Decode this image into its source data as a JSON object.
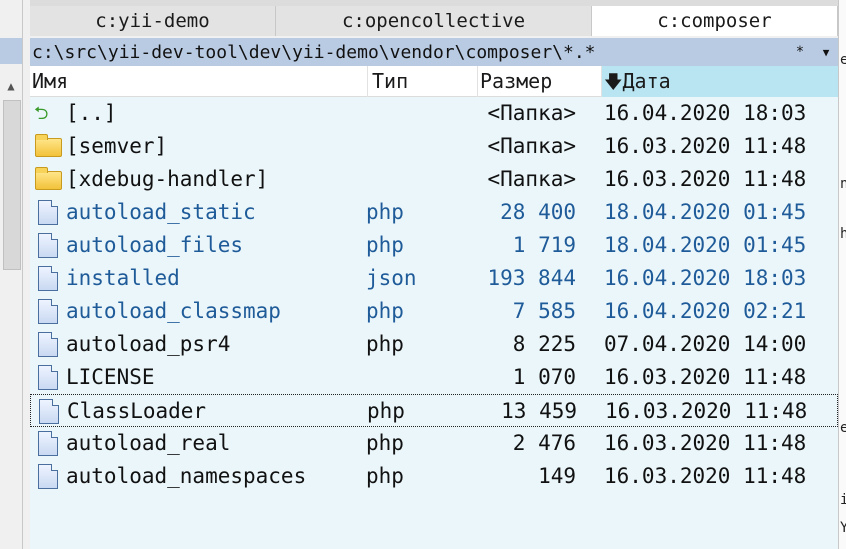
{
  "tabs": [
    {
      "label": "c:yii-demo",
      "active": false
    },
    {
      "label": "c:opencollective",
      "active": false
    },
    {
      "label": "c:composer",
      "active": true
    }
  ],
  "pathbar": {
    "path": "c:\\src\\yii-dev-tool\\dev\\yii-demo\\vendor\\composer\\*.*",
    "mask": "*",
    "dropdown_icon": "chevron-down-icon"
  },
  "columns": {
    "name": "Имя",
    "type": "Тип",
    "size": "Размер",
    "date": "Дата",
    "sort_icon": "sort-down-arrow-icon"
  },
  "files": [
    {
      "icon": "parent-dir-icon",
      "name": "[..]",
      "type": "",
      "size": "<Папка>",
      "date": "16.04.2020 18:03",
      "highlight": false
    },
    {
      "icon": "folder-icon",
      "name": "[semver]",
      "type": "",
      "size": "<Папка>",
      "date": "16.03.2020 11:48",
      "highlight": false
    },
    {
      "icon": "folder-icon",
      "name": "[xdebug-handler]",
      "type": "",
      "size": "<Папка>",
      "date": "16.03.2020 11:48",
      "highlight": false
    },
    {
      "icon": "file-icon",
      "name": "autoload_static",
      "type": "php",
      "size": "28 400",
      "date": "18.04.2020 01:45",
      "highlight": true
    },
    {
      "icon": "file-icon",
      "name": "autoload_files",
      "type": "php",
      "size": "1 719",
      "date": "18.04.2020 01:45",
      "highlight": true
    },
    {
      "icon": "file-icon",
      "name": "installed",
      "type": "json",
      "size": "193 844",
      "date": "16.04.2020 18:03",
      "highlight": true
    },
    {
      "icon": "file-icon",
      "name": "autoload_classmap",
      "type": "php",
      "size": "7 585",
      "date": "16.04.2020 02:21",
      "highlight": true
    },
    {
      "icon": "file-icon",
      "name": "autoload_psr4",
      "type": "php",
      "size": "8 225",
      "date": "07.04.2020 14:00",
      "highlight": false
    },
    {
      "icon": "file-icon",
      "name": "LICENSE",
      "type": "",
      "size": "1 070",
      "date": "16.03.2020 11:48",
      "highlight": false
    },
    {
      "icon": "file-icon",
      "name": "ClassLoader",
      "type": "php",
      "size": "13 459",
      "date": "16.03.2020 11:48",
      "highlight": false,
      "focused": true
    },
    {
      "icon": "file-icon",
      "name": "autoload_real",
      "type": "php",
      "size": "2 476",
      "date": "16.03.2020 11:48",
      "highlight": false
    },
    {
      "icon": "file-icon",
      "name": "autoload_namespaces",
      "type": "php",
      "size": "149",
      "date": "16.03.2020 11:48",
      "highlight": false
    }
  ],
  "colors": {
    "highlight_text": "#1f5b99",
    "pathbar_bg": "#b9cbe3",
    "list_bg": "#eaf6fa",
    "sort_column_bg": "#b9e4f2"
  }
}
